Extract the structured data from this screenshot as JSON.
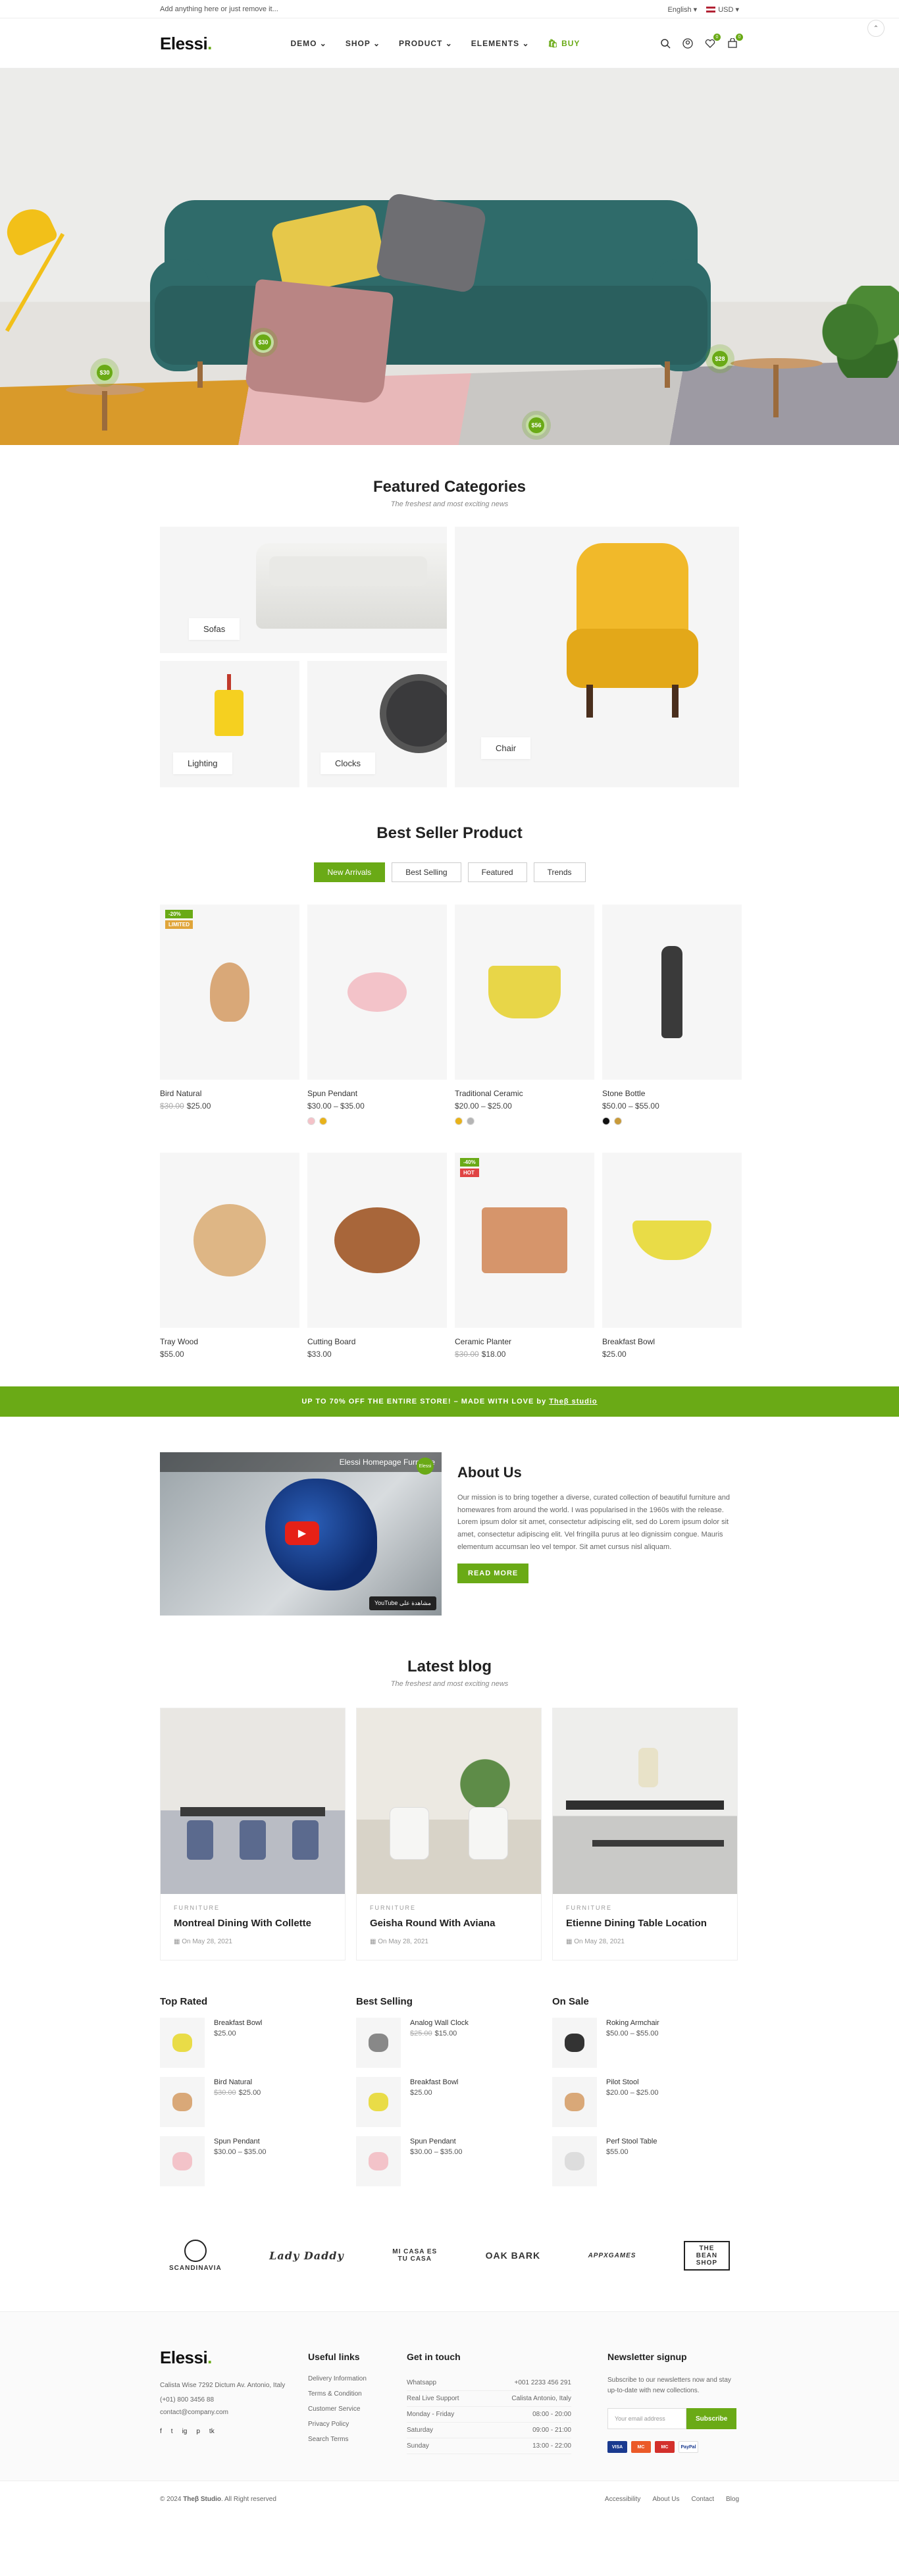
{
  "topbar": {
    "notice": "Add anything here or just remove it...",
    "language": "English",
    "currency": "USD"
  },
  "header": {
    "logo": "Elessi",
    "logo_dot": ".",
    "nav": [
      {
        "label": "DEMO",
        "chevron": true
      },
      {
        "label": "SHOP",
        "chevron": true
      },
      {
        "label": "PRODUCT",
        "chevron": true
      },
      {
        "label": "ELEMENTS",
        "chevron": true
      },
      {
        "label": "BUY",
        "chevron": false
      }
    ],
    "wishlist_count": "0",
    "cart_count": "0"
  },
  "hero": {
    "hotspots": [
      "$30",
      "$30",
      "$56",
      "$28"
    ]
  },
  "categories": {
    "title": "Featured Categories",
    "subtitle": "The freshest and most exciting news",
    "items": [
      {
        "label": "Sofas"
      },
      {
        "label": "Chair"
      },
      {
        "label": "Lighting"
      },
      {
        "label": "Clocks"
      }
    ]
  },
  "bestseller": {
    "title": "Best Seller Product",
    "tabs": [
      "New Arrivals",
      "Best Selling",
      "Featured",
      "Trends"
    ],
    "products": [
      {
        "name": "Bird Natural",
        "old": "$30.00",
        "price": "$25.00",
        "badges": [
          "-20%",
          "LIMITED"
        ],
        "swatches": []
      },
      {
        "name": "Spun Pendant",
        "old": "",
        "price": "$30.00 – $35.00",
        "badges": [],
        "swatches": [
          "#f4c2c8",
          "#e8b21a"
        ]
      },
      {
        "name": "Traditional Ceramic",
        "old": "",
        "price": "$20.00 – $25.00",
        "badges": [],
        "swatches": [
          "#e8b21a",
          "#b5b5b5"
        ]
      },
      {
        "name": "Stone Bottle",
        "old": "",
        "price": "$50.00 – $55.00",
        "badges": [],
        "swatches": [
          "#111111",
          "#c89a3a"
        ]
      },
      {
        "name": "Tray Wood",
        "old": "",
        "price": "$55.00",
        "badges": [],
        "swatches": []
      },
      {
        "name": "Cutting Board",
        "old": "",
        "price": "$33.00",
        "badges": [],
        "swatches": []
      },
      {
        "name": "Ceramic Planter",
        "old": "$30.00",
        "price": "$18.00",
        "badges": [
          "-40%",
          "HOT"
        ],
        "swatches": []
      },
      {
        "name": "Breakfast Bowl",
        "old": "",
        "price": "$25.00",
        "badges": [],
        "swatches": []
      }
    ]
  },
  "promo": {
    "text": "UP TO 70% OFF THE ENTIRE STORE! – MADE WITH LOVE by",
    "link": "Theβ studio"
  },
  "about": {
    "video_title": "Elessi Homepage Furniture",
    "channel": "Elessi",
    "yt_label": "YouTube مشاهدة على",
    "title": "About Us",
    "p1": "Our mission is to bring together a diverse, curated collection of beautiful furniture and homewares from around the world. I was popularised in the 1960s with the release.",
    "p2": "Lorem ipsum dolor sit amet, consectetur adipiscing elit, sed do Lorem ipsum dolor sit amet, consectetur adipiscing elit. Vel fringilla purus at leo dignissim congue. Mauris elementum accumsan leo vel tempor. Sit amet cursus nisl aliquam.",
    "button": "READ MORE"
  },
  "blog": {
    "title": "Latest blog",
    "subtitle": "The freshest and most exciting news",
    "posts": [
      {
        "category": "FURNITURE",
        "title": "Montreal Dining With Collette",
        "date": "On May 28, 2021"
      },
      {
        "category": "FURNITURE",
        "title": "Geisha Round With Aviana",
        "date": "On May 28, 2021"
      },
      {
        "category": "FURNITURE",
        "title": "Etienne Dining Table Location",
        "date": "On May 28, 2021"
      }
    ]
  },
  "mini_lists": [
    {
      "title": "Top Rated",
      "items": [
        {
          "name": "Breakfast Bowl",
          "old": "",
          "price": "$25.00"
        },
        {
          "name": "Bird Natural",
          "old": "$30.00",
          "price": "$25.00"
        },
        {
          "name": "Spun Pendant",
          "old": "",
          "price": "$30.00 – $35.00"
        }
      ]
    },
    {
      "title": "Best Selling",
      "items": [
        {
          "name": "Analog Wall Clock",
          "old": "$25.00",
          "price": "$15.00"
        },
        {
          "name": "Breakfast Bowl",
          "old": "",
          "price": "$25.00"
        },
        {
          "name": "Spun Pendant",
          "old": "",
          "price": "$30.00 – $35.00"
        }
      ]
    },
    {
      "title": "On Sale",
      "items": [
        {
          "name": "Roking Armchair",
          "old": "",
          "price": "$50.00 – $55.00"
        },
        {
          "name": "Pilot Stool",
          "old": "",
          "price": "$20.00 – $25.00"
        },
        {
          "name": "Perf Stool Table",
          "old": "",
          "price": "$55.00"
        }
      ]
    }
  ],
  "brands": [
    "SCANDINAVIA",
    "Lady Daddy",
    "MI CASA ES TU CASA",
    "OAK BARK",
    "APPXGAMES",
    "THE BEAN SHOP"
  ],
  "footer": {
    "logo": "Elessi",
    "address": "Calista Wise 7292 Dictum Av. Antonio, Italy",
    "phone": "(+01) 800 3456 88",
    "email": "contact@company.com",
    "socials": [
      "f",
      "t",
      "ig",
      "p",
      "tk"
    ],
    "useful_title": "Useful links",
    "useful": [
      "Delivery Information",
      "Terms & Condition",
      "Customer Service",
      "Privacy Policy",
      "Search Terms"
    ],
    "touch_title": "Get in touch",
    "touch": [
      {
        "k": "Whatsapp",
        "v": "+001 2233 456 291"
      },
      {
        "k": "Real Live Support",
        "v": "Calista Antonio, Italy"
      },
      {
        "k": "Monday - Friday",
        "v": "08:00 - 20:00"
      },
      {
        "k": "Saturday",
        "v": "09:00 - 21:00"
      },
      {
        "k": "Sunday",
        "v": "13:00 - 22:00"
      }
    ],
    "news_title": "Newsletter signup",
    "news_text": "Subscribe to our newsletters now and stay up-to-date with new collections.",
    "email_placeholder": "Your email address",
    "subscribe": "Subscribe",
    "cards": [
      "VISA",
      "MC",
      "MC",
      "PayPal"
    ]
  },
  "bottom": {
    "copyright": "© 2024",
    "studio": "Theβ Studio",
    "rights": ". All Right reserved",
    "links": [
      "Accessibility",
      "About Us",
      "Contact",
      "Blog"
    ]
  }
}
